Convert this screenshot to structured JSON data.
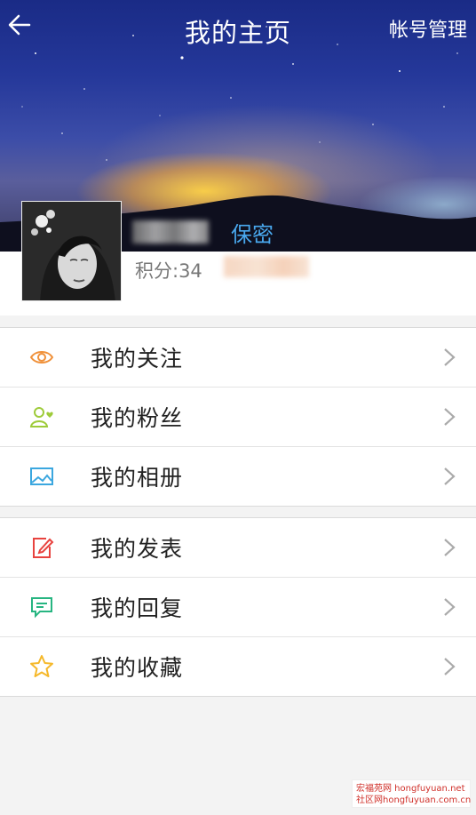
{
  "header": {
    "title": "我的主页",
    "account_label": "帐号管理"
  },
  "profile": {
    "privacy_label": "保密",
    "points_label": "积分:34"
  },
  "menu_groups": [
    {
      "items": [
        {
          "label": "我的关注",
          "icon": "eye-icon",
          "color": "#f0913a"
        },
        {
          "label": "我的粉丝",
          "icon": "user-heart-icon",
          "color": "#9ecb3a"
        },
        {
          "label": "我的相册",
          "icon": "picture-icon",
          "color": "#3ba7df"
        }
      ]
    },
    {
      "items": [
        {
          "label": "我的发表",
          "icon": "edit-icon",
          "color": "#e8433f"
        },
        {
          "label": "我的回复",
          "icon": "comment-icon",
          "color": "#27b581"
        },
        {
          "label": "我的收藏",
          "icon": "star-icon",
          "color": "#f5b82a"
        }
      ]
    }
  ],
  "watermark": {
    "line1": "宏福苑网  hongfuyuan.net",
    "line2": "社区网hongfuyuan.com.cn"
  }
}
